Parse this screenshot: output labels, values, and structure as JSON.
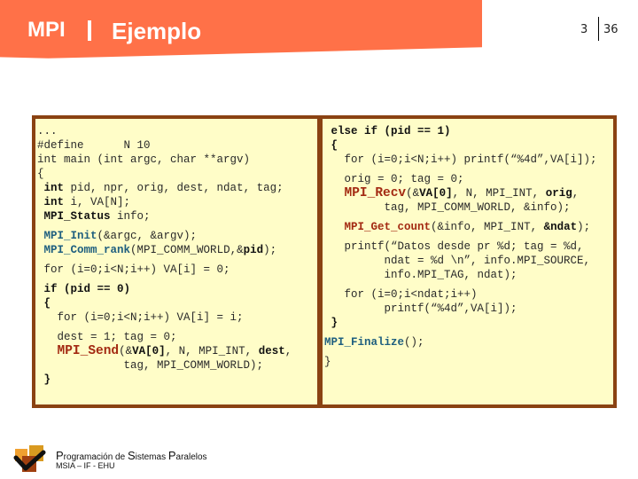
{
  "header": {
    "section": "MPI",
    "title": "Ejemplo",
    "page_current": "3",
    "page_total": "36"
  },
  "code_left": [
    {
      "segments": [
        {
          "t": "...",
          "s": ""
        }
      ]
    },
    {
      "segments": [
        {
          "t": "#define      N 10",
          "s": ""
        }
      ]
    },
    {
      "segments": [
        {
          "t": "int main (int argc, char **argv)",
          "s": ""
        }
      ]
    },
    {
      "segments": [
        {
          "t": "{",
          "s": ""
        }
      ]
    },
    {
      "segments": [
        {
          "t": " ",
          "s": ""
        },
        {
          "t": "int",
          "s": "b"
        },
        {
          "t": " pid, npr, orig, dest, ndat, tag;",
          "s": ""
        }
      ]
    },
    {
      "segments": [
        {
          "t": " ",
          "s": ""
        },
        {
          "t": "int",
          "s": "b"
        },
        {
          "t": " i, VA[N];",
          "s": ""
        }
      ]
    },
    {
      "segments": [
        {
          "t": " ",
          "s": ""
        },
        {
          "t": "MPI_Status",
          "s": "b"
        },
        {
          "t": " info;",
          "s": ""
        }
      ]
    },
    {
      "gap": true
    },
    {
      "segments": [
        {
          "t": " ",
          "s": ""
        },
        {
          "t": "MPI_Init",
          "s": "fn-blue"
        },
        {
          "t": "(&argc, &argv);",
          "s": ""
        }
      ]
    },
    {
      "segments": [
        {
          "t": " ",
          "s": ""
        },
        {
          "t": "MPI_Comm_rank",
          "s": "fn-blue"
        },
        {
          "t": "(MPI_COMM_WORLD,&",
          "s": ""
        },
        {
          "t": "pid",
          "s": "b"
        },
        {
          "t": ");",
          "s": ""
        }
      ]
    },
    {
      "gap": true
    },
    {
      "segments": [
        {
          "t": " for (i=0;i<N;i++) VA[i] = 0;",
          "s": ""
        }
      ]
    },
    {
      "gap": true
    },
    {
      "segments": [
        {
          "t": " ",
          "s": ""
        },
        {
          "t": "if (pid == 0)",
          "s": "b"
        }
      ]
    },
    {
      "segments": [
        {
          "t": " ",
          "s": ""
        },
        {
          "t": "{",
          "s": "b"
        }
      ]
    },
    {
      "segments": [
        {
          "t": "   for (i=0;i<N;i++) VA[i] = i;",
          "s": ""
        }
      ]
    },
    {
      "gap": true
    },
    {
      "segments": [
        {
          "t": "   dest = 1; tag = 0;",
          "s": ""
        }
      ]
    },
    {
      "segments": [
        {
          "t": "   ",
          "s": ""
        },
        {
          "t": "MPI_Send",
          "s": "fn-red"
        },
        {
          "t": "(&",
          "s": ""
        },
        {
          "t": "VA[0]",
          "s": "b"
        },
        {
          "t": ", N, MPI_INT, ",
          "s": ""
        },
        {
          "t": "dest",
          "s": "b"
        },
        {
          "t": ",",
          "s": ""
        }
      ]
    },
    {
      "segments": [
        {
          "t": "             tag, MPI_COMM_WORLD);",
          "s": ""
        }
      ]
    },
    {
      "segments": [
        {
          "t": " ",
          "s": ""
        },
        {
          "t": "}",
          "s": "b"
        }
      ]
    }
  ],
  "code_right": [
    {
      "segments": [
        {
          "t": " ",
          "s": ""
        },
        {
          "t": "else if (pid == 1)",
          "s": "b"
        }
      ]
    },
    {
      "segments": [
        {
          "t": " ",
          "s": ""
        },
        {
          "t": "{",
          "s": "b"
        }
      ]
    },
    {
      "segments": [
        {
          "t": "   for (i=0;i<N;i++) printf(“%4d”,VA[i]);",
          "s": ""
        }
      ]
    },
    {
      "gap": true
    },
    {
      "segments": [
        {
          "t": "   orig = 0; tag = 0;",
          "s": ""
        }
      ]
    },
    {
      "segments": [
        {
          "t": "   ",
          "s": ""
        },
        {
          "t": "MPI_Recv",
          "s": "fn-red"
        },
        {
          "t": "(&",
          "s": ""
        },
        {
          "t": "VA[0]",
          "s": "b"
        },
        {
          "t": ", N, MPI_INT, ",
          "s": ""
        },
        {
          "t": "orig",
          "s": "b"
        },
        {
          "t": ",",
          "s": ""
        }
      ]
    },
    {
      "segments": [
        {
          "t": "         tag, MPI_COMM_WORLD, &info);",
          "s": ""
        }
      ]
    },
    {
      "gap": true
    },
    {
      "segments": [
        {
          "t": "   ",
          "s": ""
        },
        {
          "t": "MPI_Get_count",
          "s": "fn-red-small"
        },
        {
          "t": "(&info, MPI_INT, ",
          "s": ""
        },
        {
          "t": "&ndat",
          "s": "b"
        },
        {
          "t": ");",
          "s": ""
        }
      ]
    },
    {
      "gap": true
    },
    {
      "segments": [
        {
          "t": "   printf(“Datos desde pr %d; tag = %d,",
          "s": ""
        }
      ]
    },
    {
      "segments": [
        {
          "t": "         ndat = %d \\n”, info.MPI_SOURCE,",
          "s": ""
        }
      ]
    },
    {
      "segments": [
        {
          "t": "         info.MPI_TAG, ndat);",
          "s": ""
        }
      ]
    },
    {
      "gap": true
    },
    {
      "segments": [
        {
          "t": "   for (i=0;i<ndat;i++)",
          "s": ""
        }
      ]
    },
    {
      "segments": [
        {
          "t": "         printf(“%4d”,VA[i]);",
          "s": ""
        }
      ]
    },
    {
      "segments": [
        {
          "t": " ",
          "s": ""
        },
        {
          "t": "}",
          "s": "b"
        }
      ]
    },
    {
      "gap": true
    },
    {
      "segments": [
        {
          "t": "MPI_Finalize",
          "s": "fn-blue"
        },
        {
          "t": "();",
          "s": ""
        }
      ]
    },
    {
      "gap": true
    },
    {
      "segments": [
        {
          "t": "}",
          "s": ""
        }
      ]
    }
  ],
  "footer": {
    "course_p": "P",
    "course_1": "rogramación de ",
    "course_s": "S",
    "course_2": "istemas ",
    "course_p2": "P",
    "course_3": "aralelos",
    "institution": "MSIA – IF - EHU"
  },
  "colors": {
    "banner": "#ff7148",
    "panel_bg": "#fffdc8",
    "panel_border": "#8a4212",
    "fn_blue": "#1f5f7f",
    "fn_red": "#a32a12"
  }
}
